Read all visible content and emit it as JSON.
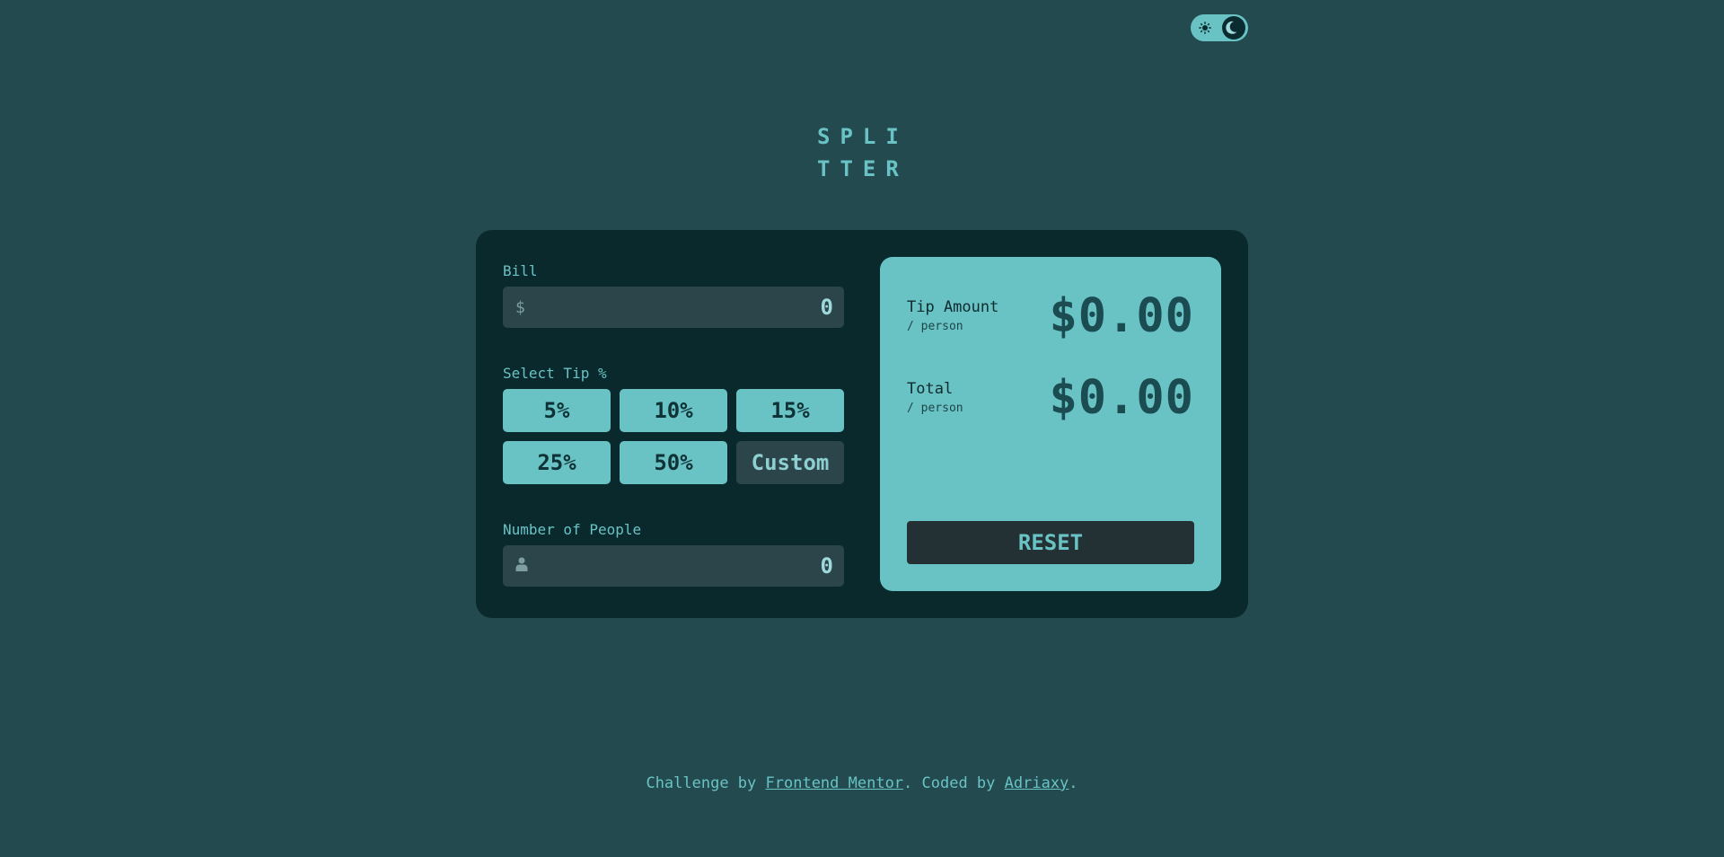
{
  "theme_toggle": {
    "light_icon": "sun-icon",
    "dark_icon": "moon-icon",
    "active": "dark"
  },
  "logo": {
    "line1": "SPLI",
    "line2": "TTER"
  },
  "bill": {
    "label": "Bill",
    "prefix": "$",
    "value": "0"
  },
  "tip": {
    "label": "Select Tip %",
    "options": [
      "5%",
      "10%",
      "15%",
      "25%",
      "50%"
    ],
    "custom_label": "Custom"
  },
  "people": {
    "label": "Number of People",
    "icon": "person-icon",
    "value": "0"
  },
  "results": {
    "tip_amount": {
      "title": "Tip Amount",
      "sub": "/ person",
      "value": "$0.00"
    },
    "total": {
      "title": "Total",
      "sub": "/ person",
      "value": "$0.00"
    },
    "reset_label": "RESET"
  },
  "footer": {
    "prefix": "Challenge by ",
    "link1": "Frontend Mentor",
    "middle": ". Coded by ",
    "link2": "Adriaxy",
    "suffix": "."
  },
  "colors": {
    "page_bg": "#224a4f",
    "card_bg": "#09292d",
    "accent": "#69c3c5",
    "input_bg": "#2b454a"
  }
}
